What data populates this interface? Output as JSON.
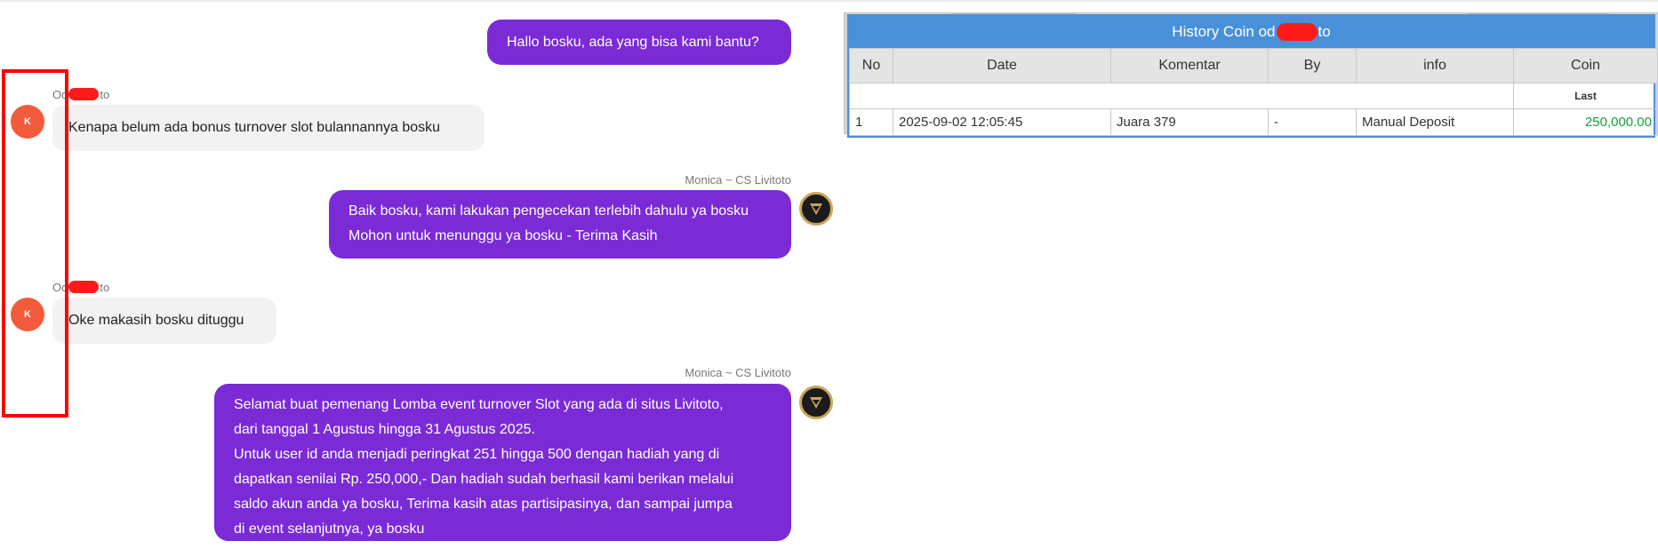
{
  "chat": {
    "messages": [
      {
        "side": "out",
        "lines": [
          "Hallo bosku, ada yang bisa kami bantu?"
        ]
      },
      {
        "side": "in",
        "sender_prefix": "Od",
        "sender_suffix": "to",
        "avatar_initial": "K",
        "text": "Kenapa belum ada bonus turnover slot bulannannya bosku"
      },
      {
        "side": "out",
        "sender": "Monica ~ CS Livitoto",
        "lines": [
          "Baik bosku, kami lakukan pengecekan terlebih dahulu ya bosku",
          "Mohon untuk menunggu ya bosku - Terima Kasih"
        ]
      },
      {
        "side": "in",
        "sender_prefix": "Od",
        "sender_suffix": "to",
        "avatar_initial": "K",
        "text": "Oke makasih bosku dituggu"
      },
      {
        "side": "out",
        "sender": "Monica ~ CS Livitoto",
        "lines": [
          "Selamat buat pemenang Lomba event turnover Slot yang ada di situs Livitoto,",
          "dari tanggal 1 Agustus hingga 31 Agustus 2025.",
          "Untuk user id anda menjadi peringkat 251 hingga 500 dengan hadiah yang di",
          "dapatkan senilai Rp. 250,000,- Dan hadiah sudah berhasil kami berikan melalui",
          "saldo akun anda ya bosku, Terima kasih atas partisipasinya, dan sampai jumpa",
          "di event selanjutnya, ya bosku"
        ]
      }
    ]
  },
  "history": {
    "title_prefix": "History Coin od",
    "title_suffix": "to",
    "columns": [
      "No",
      "Date",
      "Komentar",
      "By",
      "info",
      "Coin"
    ],
    "subheader": "Last",
    "rows": [
      {
        "no": "1",
        "date": "2025-09-02 12:05:45",
        "komentar": "Juara 379",
        "by": "-",
        "info": "Manual Deposit",
        "coin": "250,000.00"
      }
    ]
  },
  "colors": {
    "user_bubble": "#f2f2f2",
    "agent_bubble": "#7a2bd6",
    "table_header": "#4a90d9",
    "coin_value": "#1a9e3e",
    "highlight_frame": "#ff0000"
  }
}
